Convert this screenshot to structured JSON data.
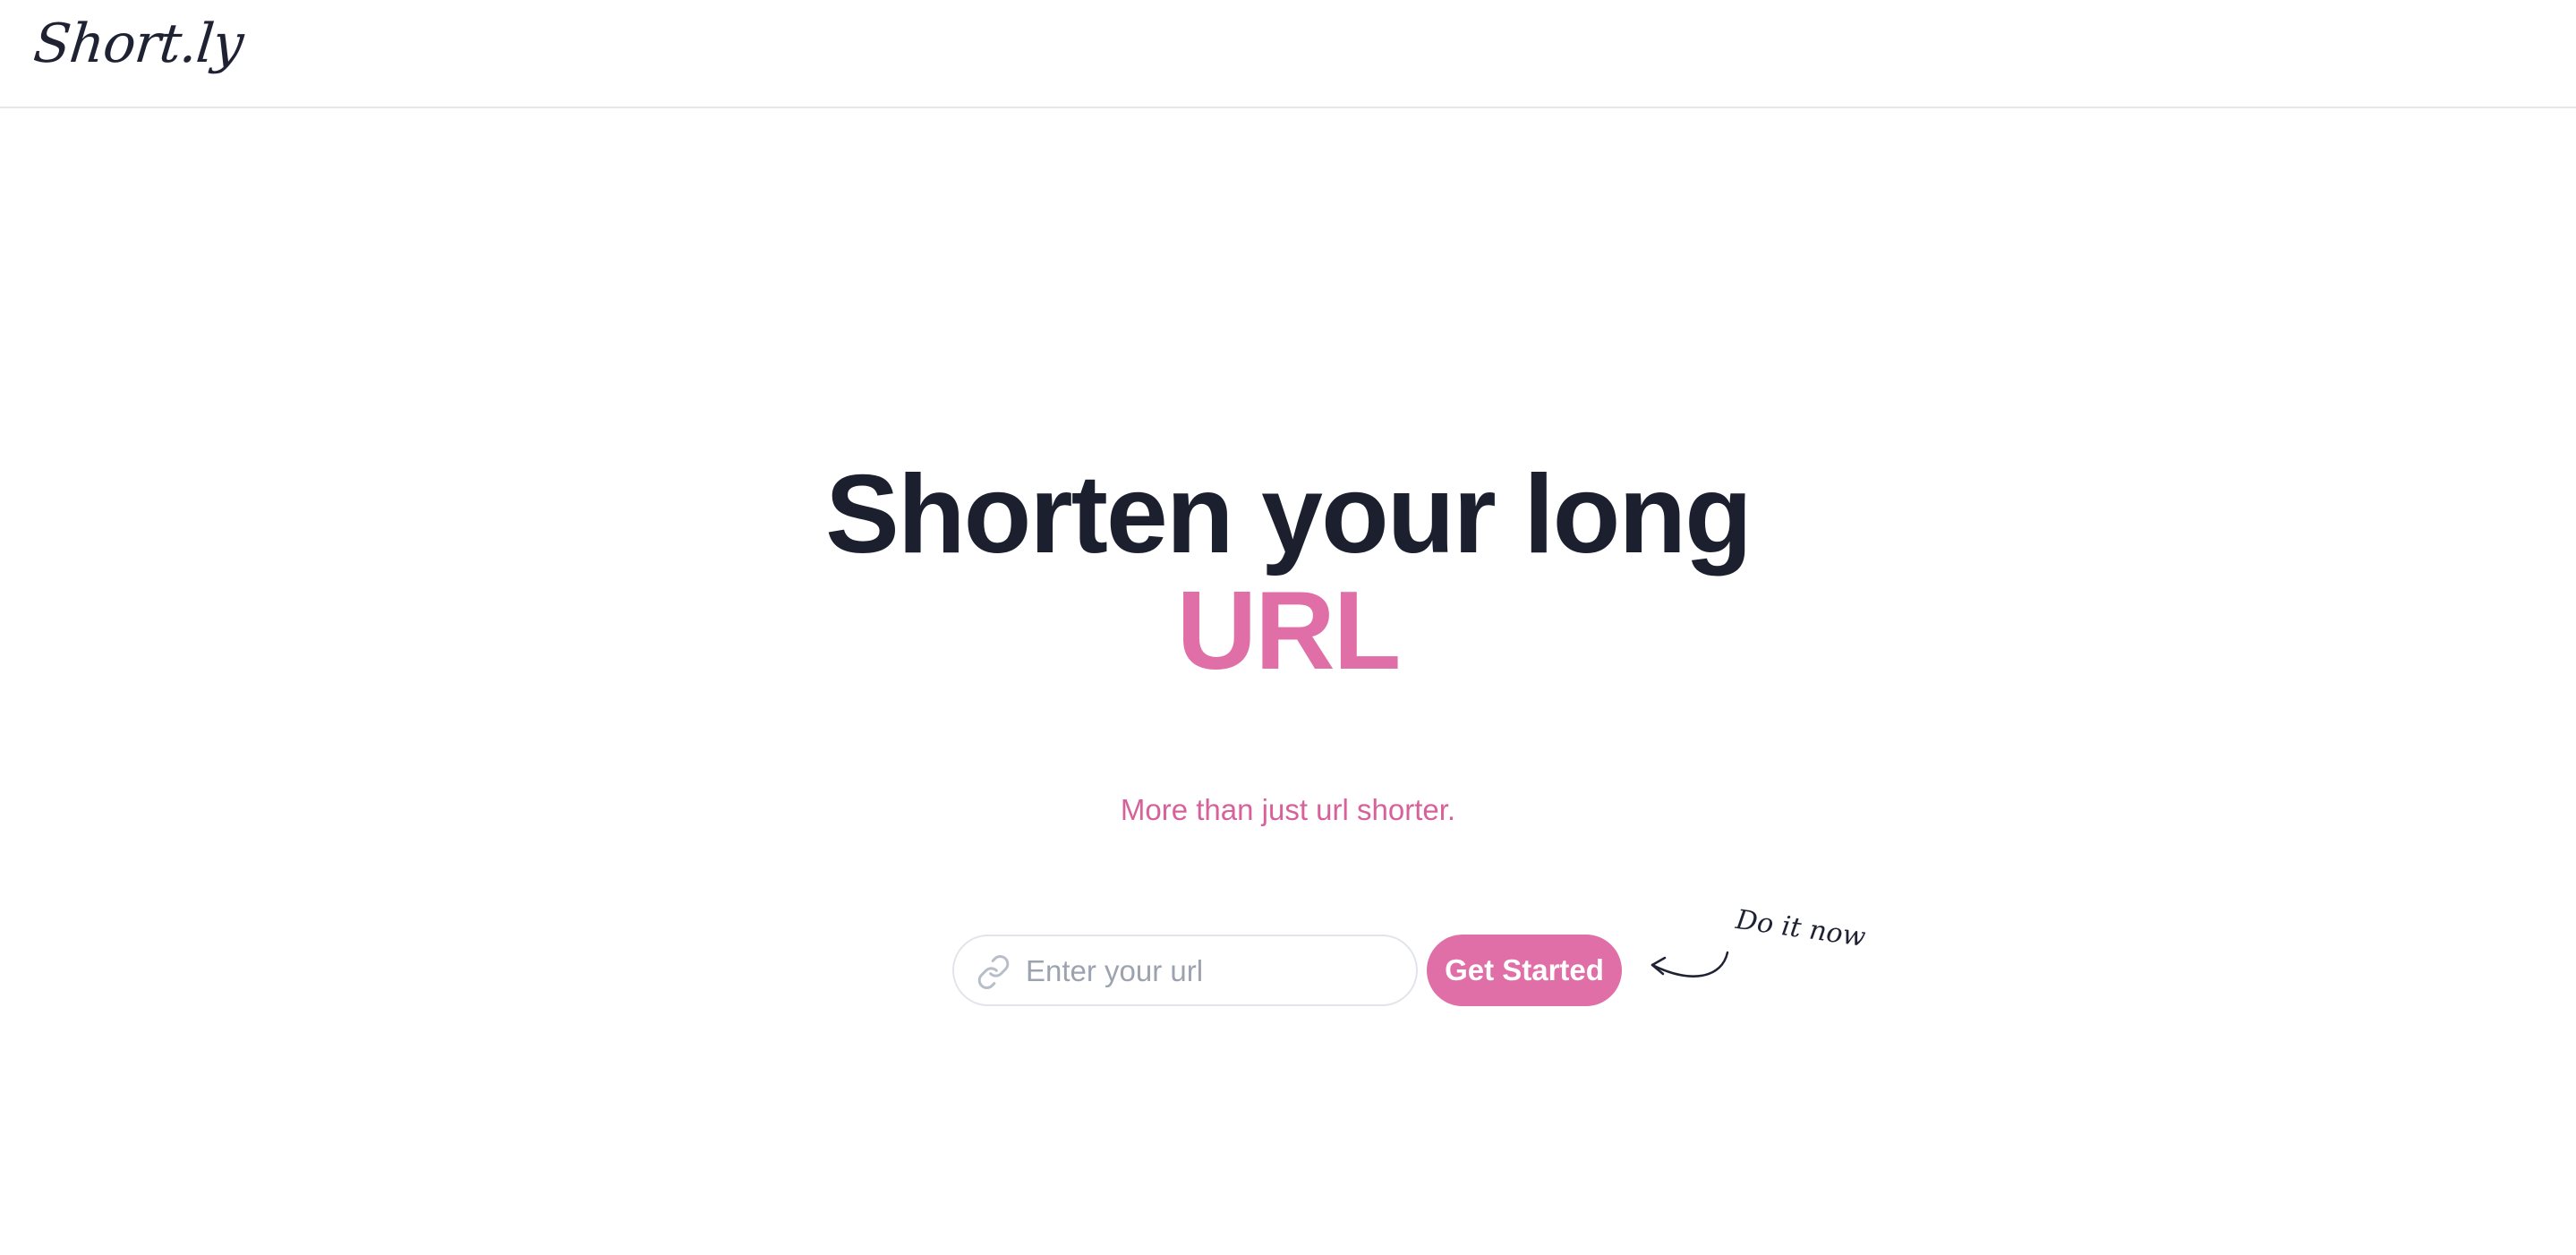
{
  "brand": {
    "name": "Short.ly"
  },
  "hero": {
    "title_line1": "Shorten your long",
    "title_accent": "URL",
    "subtitle": "More than just url shorter."
  },
  "form": {
    "url_placeholder": "Enter your url",
    "url_value": "",
    "submit_label": "Get Started",
    "field_icon": "link-icon"
  },
  "annotation": {
    "text": "Do it now",
    "icon": "curved-arrow-icon"
  },
  "colors": {
    "accent": "#df6fa6",
    "heading": "#1c1f2e",
    "border": "#e5e7eb",
    "placeholder": "#9ca3af"
  }
}
